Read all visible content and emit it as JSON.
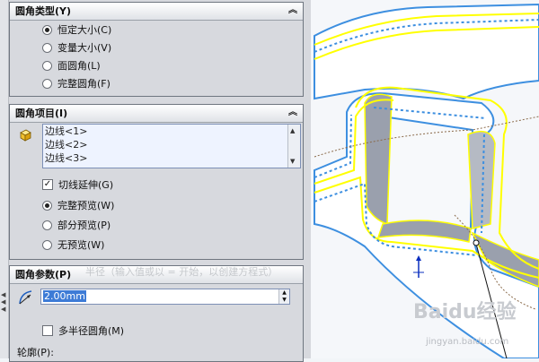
{
  "fillet_type": {
    "title": "圆角类型(Y)",
    "options": [
      {
        "label": "恒定大小(C)",
        "selected": true
      },
      {
        "label": "变量大小(V)",
        "selected": false
      },
      {
        "label": "面圆角(L)",
        "selected": false
      },
      {
        "label": "完整圆角(F)",
        "selected": false
      }
    ]
  },
  "fillet_items": {
    "title": "圆角项目(I)",
    "edges": [
      "边线<1>",
      "边线<2>",
      "边线<3>"
    ],
    "tangent_propagation": {
      "label": "切线延伸(G)",
      "checked": true
    },
    "preview_options": [
      {
        "label": "完整预览(W)",
        "selected": true
      },
      {
        "label": "部分预览(P)",
        "selected": false
      },
      {
        "label": "无预览(W)",
        "selected": false
      }
    ]
  },
  "fillet_params": {
    "title": "圆角参数(P)",
    "tooltip": "半径（输入值或以 = 开始，以创建方程式）",
    "radius_value": "2.00mm",
    "multi_radius": {
      "label": "多半径圆角(M)",
      "checked": false
    },
    "profile_label": "轮廓(P):"
  },
  "watermark": {
    "brand": "Baidu经验",
    "url": "jingyan.baidu.com"
  },
  "colors": {
    "highlight": "#ffff00",
    "edge": "#3d8fe0",
    "panel": "#d7d9de"
  }
}
